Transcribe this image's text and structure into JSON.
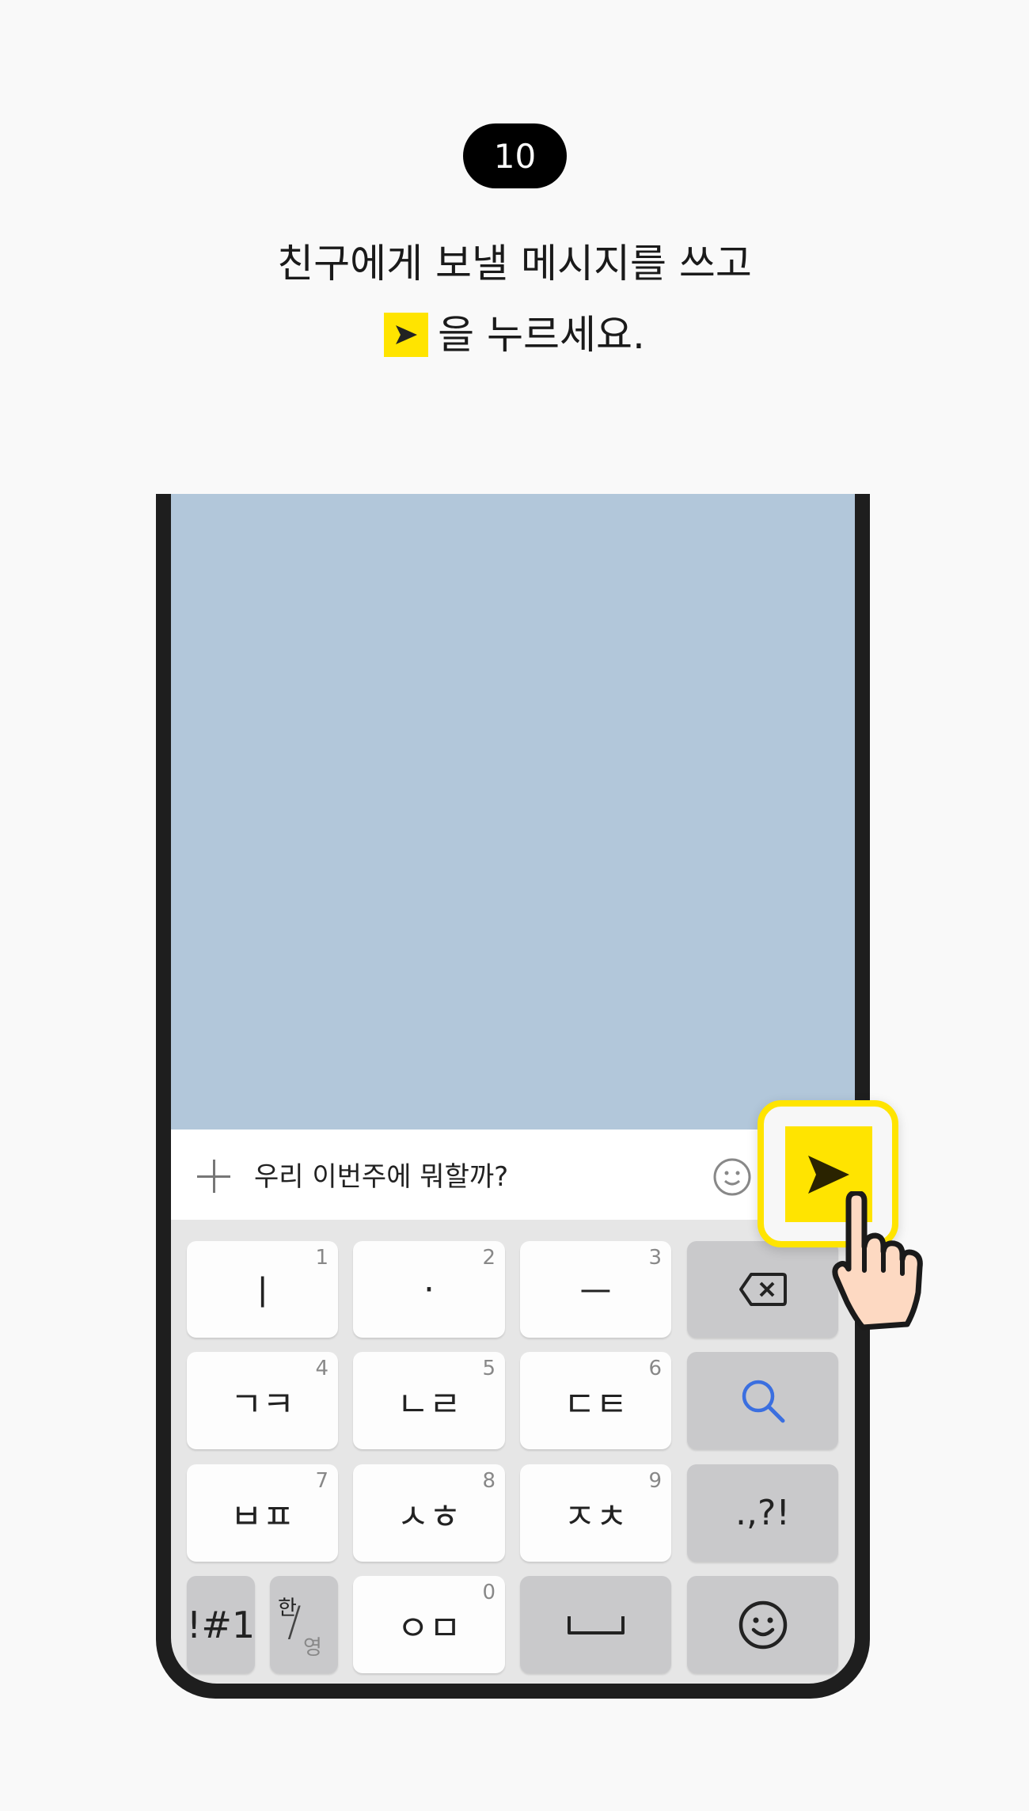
{
  "step": {
    "number": "10"
  },
  "instruction": {
    "line1": "친구에게 보낼 메시지를 쓰고",
    "line2": "을 누르세요.",
    "inline_icon": "send-icon"
  },
  "chat": {
    "background": "#b2c7da",
    "input_text": "우리 이번주에 뭐할까?",
    "plus_icon": "plus-icon",
    "emoji_icon": "emoticon-icon",
    "send_icon": "send-icon",
    "accent": "#ffe400"
  },
  "keyboard": {
    "rows": [
      [
        {
          "label": "ㅣ",
          "num": "1"
        },
        {
          "label": "·",
          "num": "2"
        },
        {
          "label": "ㅡ",
          "num": "3"
        },
        {
          "icon": "backspace-icon"
        }
      ],
      [
        {
          "label": "ㄱㅋ",
          "num": "4"
        },
        {
          "label": "ㄴㄹ",
          "num": "5"
        },
        {
          "label": "ㄷㅌ",
          "num": "6"
        },
        {
          "icon": "search-icon"
        }
      ],
      [
        {
          "label": "ㅂㅍ",
          "num": "7"
        },
        {
          "label": "ㅅㅎ",
          "num": "8"
        },
        {
          "label": "ㅈㅊ",
          "num": "9"
        },
        {
          "label": ".,?!"
        }
      ],
      [
        {
          "label": "!#1"
        },
        {
          "label_top": "한",
          "label_bottom": "영"
        },
        {
          "label": "ㅇㅁ",
          "num": "0"
        },
        {
          "icon": "space-icon"
        },
        {
          "icon": "emoji-icon"
        }
      ]
    ]
  }
}
